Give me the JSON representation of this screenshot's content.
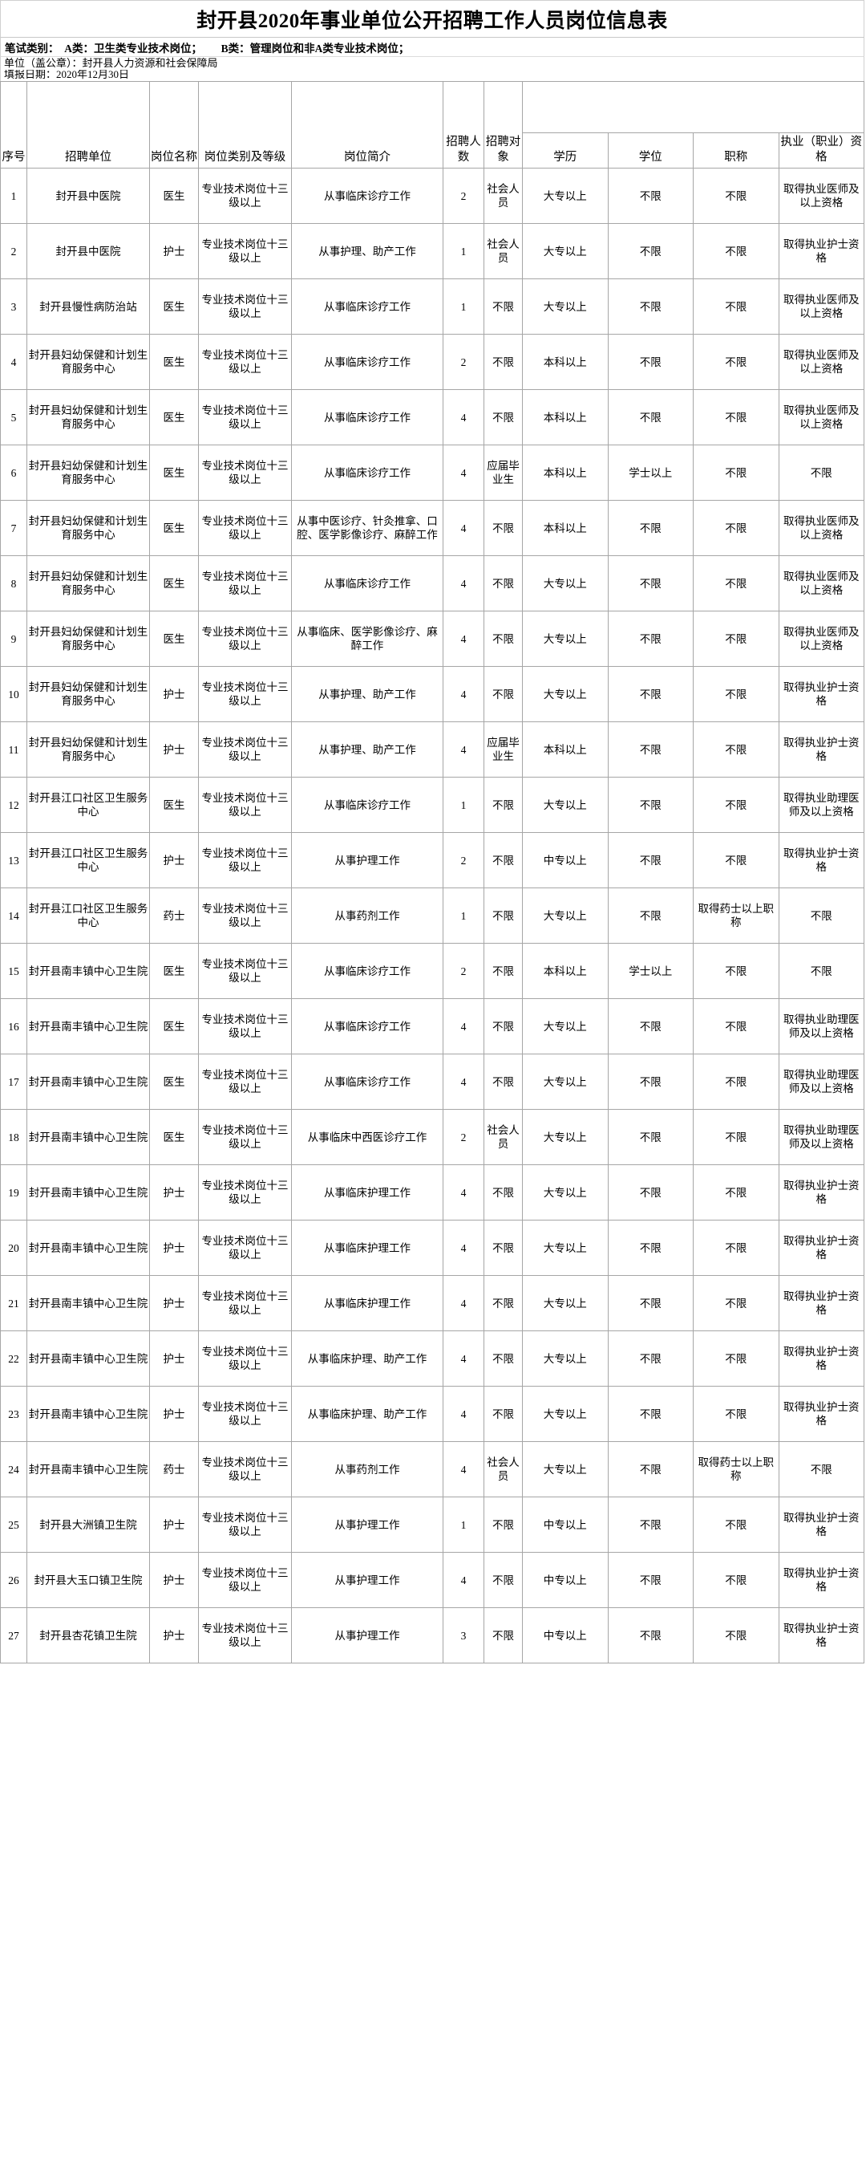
{
  "document": {
    "title": "封开县2020年事业单位公开招聘工作人员岗位信息表",
    "exam_note": "笔试类别：  A类：卫生类专业技术岗位；       B类：管理岗位和非A类专业技术岗位；",
    "unit_line": "单位（盖公章）：封开县人力资源和社会保障局",
    "date_line": "填报日期：2020年12月30日"
  },
  "table": {
    "headers": {
      "index": "序号",
      "unit": "招聘单位",
      "post_name": "岗位名称",
      "post_category": "岗位类别及等级",
      "post_desc": "岗位简介",
      "headcount": "招聘人数",
      "target": "招聘对象",
      "requirements_group": "",
      "education": "学历",
      "degree": "学位",
      "title": "职称",
      "qualification": "执业（职业）资格"
    },
    "rows": [
      {
        "index": "1",
        "unit": "封开县中医院",
        "post_name": "医生",
        "post_category": "专业技术岗位十三级以上",
        "post_desc": "从事临床诊疗工作",
        "headcount": "2",
        "target": "社会人员",
        "education": "大专以上",
        "degree": "不限",
        "title": "不限",
        "qualification": "取得执业医师及以上资格"
      },
      {
        "index": "2",
        "unit": "封开县中医院",
        "post_name": "护士",
        "post_category": "专业技术岗位十三级以上",
        "post_desc": "从事护理、助产工作",
        "headcount": "1",
        "target": "社会人员",
        "education": "大专以上",
        "degree": "不限",
        "title": "不限",
        "qualification": "取得执业护士资格"
      },
      {
        "index": "3",
        "unit": "封开县慢性病防治站",
        "post_name": "医生",
        "post_category": "专业技术岗位十三级以上",
        "post_desc": "从事临床诊疗工作",
        "headcount": "1",
        "target": "不限",
        "education": "大专以上",
        "degree": "不限",
        "title": "不限",
        "qualification": "取得执业医师及以上资格"
      },
      {
        "index": "4",
        "unit": "封开县妇幼保健和计划生育服务中心",
        "post_name": "医生",
        "post_category": "专业技术岗位十三级以上",
        "post_desc": "从事临床诊疗工作",
        "headcount": "2",
        "target": "不限",
        "education": "本科以上",
        "degree": "不限",
        "title": "不限",
        "qualification": "取得执业医师及以上资格"
      },
      {
        "index": "5",
        "unit": "封开县妇幼保健和计划生育服务中心",
        "post_name": "医生",
        "post_category": "专业技术岗位十三级以上",
        "post_desc": "从事临床诊疗工作",
        "headcount": "4",
        "target": "不限",
        "education": "本科以上",
        "degree": "不限",
        "title": "不限",
        "qualification": "取得执业医师及以上资格"
      },
      {
        "index": "6",
        "unit": "封开县妇幼保健和计划生育服务中心",
        "post_name": "医生",
        "post_category": "专业技术岗位十三级以上",
        "post_desc": "从事临床诊疗工作",
        "headcount": "4",
        "target": "应届毕业生",
        "education": "本科以上",
        "degree": "学士以上",
        "title": "不限",
        "qualification": "不限"
      },
      {
        "index": "7",
        "unit": "封开县妇幼保健和计划生育服务中心",
        "post_name": "医生",
        "post_category": "专业技术岗位十三级以上",
        "post_desc": "从事中医诊疗、针灸推拿、口腔、医学影像诊疗、麻醉工作",
        "headcount": "4",
        "target": "不限",
        "education": "本科以上",
        "degree": "不限",
        "title": "不限",
        "qualification": "取得执业医师及以上资格"
      },
      {
        "index": "8",
        "unit": "封开县妇幼保健和计划生育服务中心",
        "post_name": "医生",
        "post_category": "专业技术岗位十三级以上",
        "post_desc": "从事临床诊疗工作",
        "headcount": "4",
        "target": "不限",
        "education": "大专以上",
        "degree": "不限",
        "title": "不限",
        "qualification": "取得执业医师及以上资格"
      },
      {
        "index": "9",
        "unit": "封开县妇幼保健和计划生育服务中心",
        "post_name": "医生",
        "post_category": "专业技术岗位十三级以上",
        "post_desc": "从事临床、医学影像诊疗、麻醉工作",
        "headcount": "4",
        "target": "不限",
        "education": "大专以上",
        "degree": "不限",
        "title": "不限",
        "qualification": "取得执业医师及以上资格"
      },
      {
        "index": "10",
        "unit": "封开县妇幼保健和计划生育服务中心",
        "post_name": "护士",
        "post_category": "专业技术岗位十三级以上",
        "post_desc": "从事护理、助产工作",
        "headcount": "4",
        "target": "不限",
        "education": "大专以上",
        "degree": "不限",
        "title": "不限",
        "qualification": "取得执业护士资格"
      },
      {
        "index": "11",
        "unit": "封开县妇幼保健和计划生育服务中心",
        "post_name": "护士",
        "post_category": "专业技术岗位十三级以上",
        "post_desc": "从事护理、助产工作",
        "headcount": "4",
        "target": "应届毕业生",
        "education": "本科以上",
        "degree": "不限",
        "title": "不限",
        "qualification": "取得执业护士资格"
      },
      {
        "index": "12",
        "unit": "封开县江口社区卫生服务中心",
        "post_name": "医生",
        "post_category": "专业技术岗位十三级以上",
        "post_desc": "从事临床诊疗工作",
        "headcount": "1",
        "target": "不限",
        "education": "大专以上",
        "degree": "不限",
        "title": "不限",
        "qualification": "取得执业助理医师及以上资格"
      },
      {
        "index": "13",
        "unit": "封开县江口社区卫生服务中心",
        "post_name": "护士",
        "post_category": "专业技术岗位十三级以上",
        "post_desc": "从事护理工作",
        "headcount": "2",
        "target": "不限",
        "education": "中专以上",
        "degree": "不限",
        "title": "不限",
        "qualification": "取得执业护士资格"
      },
      {
        "index": "14",
        "unit": "封开县江口社区卫生服务中心",
        "post_name": "药士",
        "post_category": "专业技术岗位十三级以上",
        "post_desc": "从事药剂工作",
        "headcount": "1",
        "target": "不限",
        "education": "大专以上",
        "degree": "不限",
        "title": "取得药士以上职称",
        "qualification": "不限"
      },
      {
        "index": "15",
        "unit": "封开县南丰镇中心卫生院",
        "post_name": "医生",
        "post_category": "专业技术岗位十三级以上",
        "post_desc": "从事临床诊疗工作",
        "headcount": "2",
        "target": "不限",
        "education": "本科以上",
        "degree": "学士以上",
        "title": "不限",
        "qualification": "不限"
      },
      {
        "index": "16",
        "unit": "封开县南丰镇中心卫生院",
        "post_name": "医生",
        "post_category": "专业技术岗位十三级以上",
        "post_desc": "从事临床诊疗工作",
        "headcount": "4",
        "target": "不限",
        "education": "大专以上",
        "degree": "不限",
        "title": "不限",
        "qualification": "取得执业助理医师及以上资格"
      },
      {
        "index": "17",
        "unit": "封开县南丰镇中心卫生院",
        "post_name": "医生",
        "post_category": "专业技术岗位十三级以上",
        "post_desc": "从事临床诊疗工作",
        "headcount": "4",
        "target": "不限",
        "education": "大专以上",
        "degree": "不限",
        "title": "不限",
        "qualification": "取得执业助理医师及以上资格"
      },
      {
        "index": "18",
        "unit": "封开县南丰镇中心卫生院",
        "post_name": "医生",
        "post_category": "专业技术岗位十三级以上",
        "post_desc": "从事临床中西医诊疗工作",
        "headcount": "2",
        "target": "社会人员",
        "education": "大专以上",
        "degree": "不限",
        "title": "不限",
        "qualification": "取得执业助理医师及以上资格"
      },
      {
        "index": "19",
        "unit": "封开县南丰镇中心卫生院",
        "post_name": "护士",
        "post_category": "专业技术岗位十三级以上",
        "post_desc": "从事临床护理工作",
        "headcount": "4",
        "target": "不限",
        "education": "大专以上",
        "degree": "不限",
        "title": "不限",
        "qualification": "取得执业护士资格"
      },
      {
        "index": "20",
        "unit": "封开县南丰镇中心卫生院",
        "post_name": "护士",
        "post_category": "专业技术岗位十三级以上",
        "post_desc": "从事临床护理工作",
        "headcount": "4",
        "target": "不限",
        "education": "大专以上",
        "degree": "不限",
        "title": "不限",
        "qualification": "取得执业护士资格"
      },
      {
        "index": "21",
        "unit": "封开县南丰镇中心卫生院",
        "post_name": "护士",
        "post_category": "专业技术岗位十三级以上",
        "post_desc": "从事临床护理工作",
        "headcount": "4",
        "target": "不限",
        "education": "大专以上",
        "degree": "不限",
        "title": "不限",
        "qualification": "取得执业护士资格"
      },
      {
        "index": "22",
        "unit": "封开县南丰镇中心卫生院",
        "post_name": "护士",
        "post_category": "专业技术岗位十三级以上",
        "post_desc": "从事临床护理、助产工作",
        "headcount": "4",
        "target": "不限",
        "education": "大专以上",
        "degree": "不限",
        "title": "不限",
        "qualification": "取得执业护士资格"
      },
      {
        "index": "23",
        "unit": "封开县南丰镇中心卫生院",
        "post_name": "护士",
        "post_category": "专业技术岗位十三级以上",
        "post_desc": "从事临床护理、助产工作",
        "headcount": "4",
        "target": "不限",
        "education": "大专以上",
        "degree": "不限",
        "title": "不限",
        "qualification": "取得执业护士资格"
      },
      {
        "index": "24",
        "unit": "封开县南丰镇中心卫生院",
        "post_name": "药士",
        "post_category": "专业技术岗位十三级以上",
        "post_desc": "从事药剂工作",
        "headcount": "4",
        "target": "社会人员",
        "education": "大专以上",
        "degree": "不限",
        "title": "取得药士以上职称",
        "qualification": "不限"
      },
      {
        "index": "25",
        "unit": "封开县大洲镇卫生院",
        "post_name": "护士",
        "post_category": "专业技术岗位十三级以上",
        "post_desc": "从事护理工作",
        "headcount": "1",
        "target": "不限",
        "education": "中专以上",
        "degree": "不限",
        "title": "不限",
        "qualification": "取得执业护士资格"
      },
      {
        "index": "26",
        "unit": "封开县大玉口镇卫生院",
        "post_name": "护士",
        "post_category": "专业技术岗位十三级以上",
        "post_desc": "从事护理工作",
        "headcount": "4",
        "target": "不限",
        "education": "中专以上",
        "degree": "不限",
        "title": "不限",
        "qualification": "取得执业护士资格"
      },
      {
        "index": "27",
        "unit": "封开县杏花镇卫生院",
        "post_name": "护士",
        "post_category": "专业技术岗位十三级以上",
        "post_desc": "从事护理工作",
        "headcount": "3",
        "target": "不限",
        "education": "中专以上",
        "degree": "不限",
        "title": "不限",
        "qualification": "取得执业护士资格"
      }
    ]
  }
}
